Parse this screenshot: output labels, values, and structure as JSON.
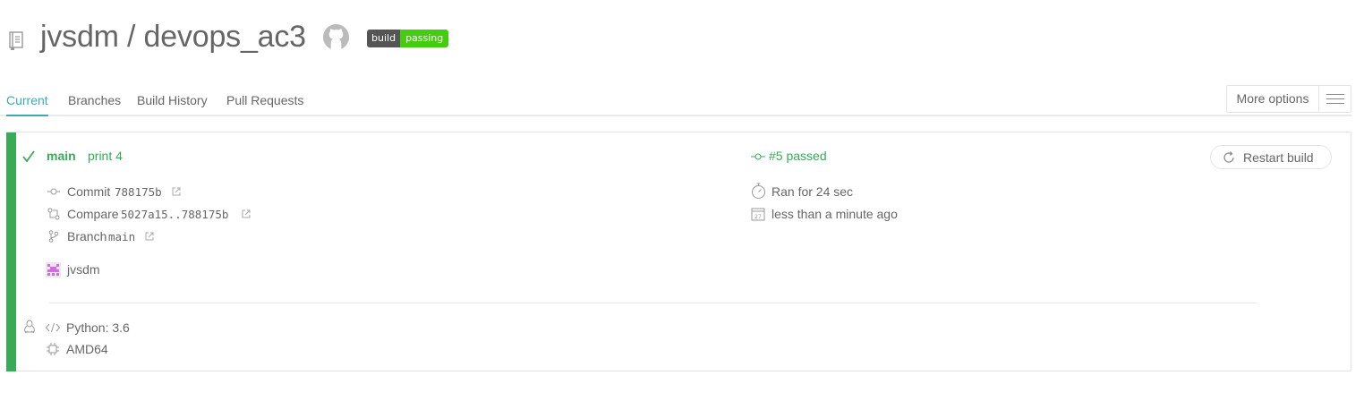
{
  "header": {
    "repo_title": "jvsdm / devops_ac3",
    "badge_left": "build",
    "badge_right": "passing"
  },
  "tabs": [
    {
      "label": "Current",
      "active": true
    },
    {
      "label": "Branches",
      "active": false
    },
    {
      "label": "Build History",
      "active": false
    },
    {
      "label": "Pull Requests",
      "active": false
    }
  ],
  "more_options": {
    "label": "More options"
  },
  "build": {
    "branch": "main",
    "message": "print 4",
    "number_status": "#5 passed",
    "restart_label": "Restart build",
    "commit_label": "Commit",
    "commit_hash": "788175b",
    "compare_label": "Compare",
    "compare_range": "5027a15..788175b",
    "branch_label": "Branch",
    "branch_name": "main",
    "author": "jvsdm",
    "duration": "Ran for 24 sec",
    "finished": "less than a minute ago",
    "language": "Python: 3.6",
    "arch": "AMD64",
    "status_color": "#39aa56"
  },
  "colors": {
    "accent": "#3eaaaf",
    "passing": "#39aa56",
    "badge_green": "#44cc11"
  }
}
